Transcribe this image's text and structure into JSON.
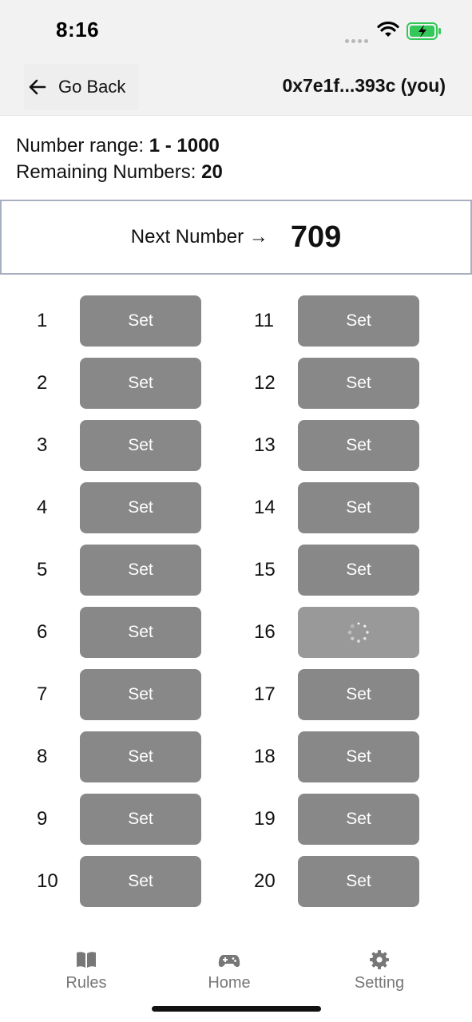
{
  "status_bar": {
    "time": "8:16"
  },
  "header": {
    "back_label": "Go Back",
    "account": "0x7e1f...393c (you)"
  },
  "info": {
    "range_label": "Number range: ",
    "range_value": "1 - 1000",
    "remaining_label": "Remaining Numbers: ",
    "remaining_value": "20"
  },
  "next": {
    "label": "Next Number →",
    "value": "709"
  },
  "slots": [
    {
      "num": "1",
      "button": "Set"
    },
    {
      "num": "2",
      "button": "Set"
    },
    {
      "num": "3",
      "button": "Set"
    },
    {
      "num": "4",
      "button": "Set"
    },
    {
      "num": "5",
      "button": "Set"
    },
    {
      "num": "6",
      "button": "Set"
    },
    {
      "num": "7",
      "button": "Set"
    },
    {
      "num": "8",
      "button": "Set"
    },
    {
      "num": "9",
      "button": "Set"
    },
    {
      "num": "10",
      "button": "Set"
    },
    {
      "num": "11",
      "button": "Set"
    },
    {
      "num": "12",
      "button": "Set"
    },
    {
      "num": "13",
      "button": "Set"
    },
    {
      "num": "14",
      "button": "Set"
    },
    {
      "num": "15",
      "button": "Set"
    },
    {
      "num": "16",
      "button": "",
      "loading": true
    },
    {
      "num": "17",
      "button": "Set"
    },
    {
      "num": "18",
      "button": "Set"
    },
    {
      "num": "19",
      "button": "Set"
    },
    {
      "num": "20",
      "button": "Set"
    }
  ],
  "tabs": [
    {
      "label": "Rules",
      "icon": "book-icon"
    },
    {
      "label": "Home",
      "icon": "gamepad-icon"
    },
    {
      "label": "Setting",
      "icon": "gear-icon"
    }
  ],
  "colors": {
    "button": "#888888",
    "border": "#a8b0c0",
    "battery": "#34c759"
  }
}
